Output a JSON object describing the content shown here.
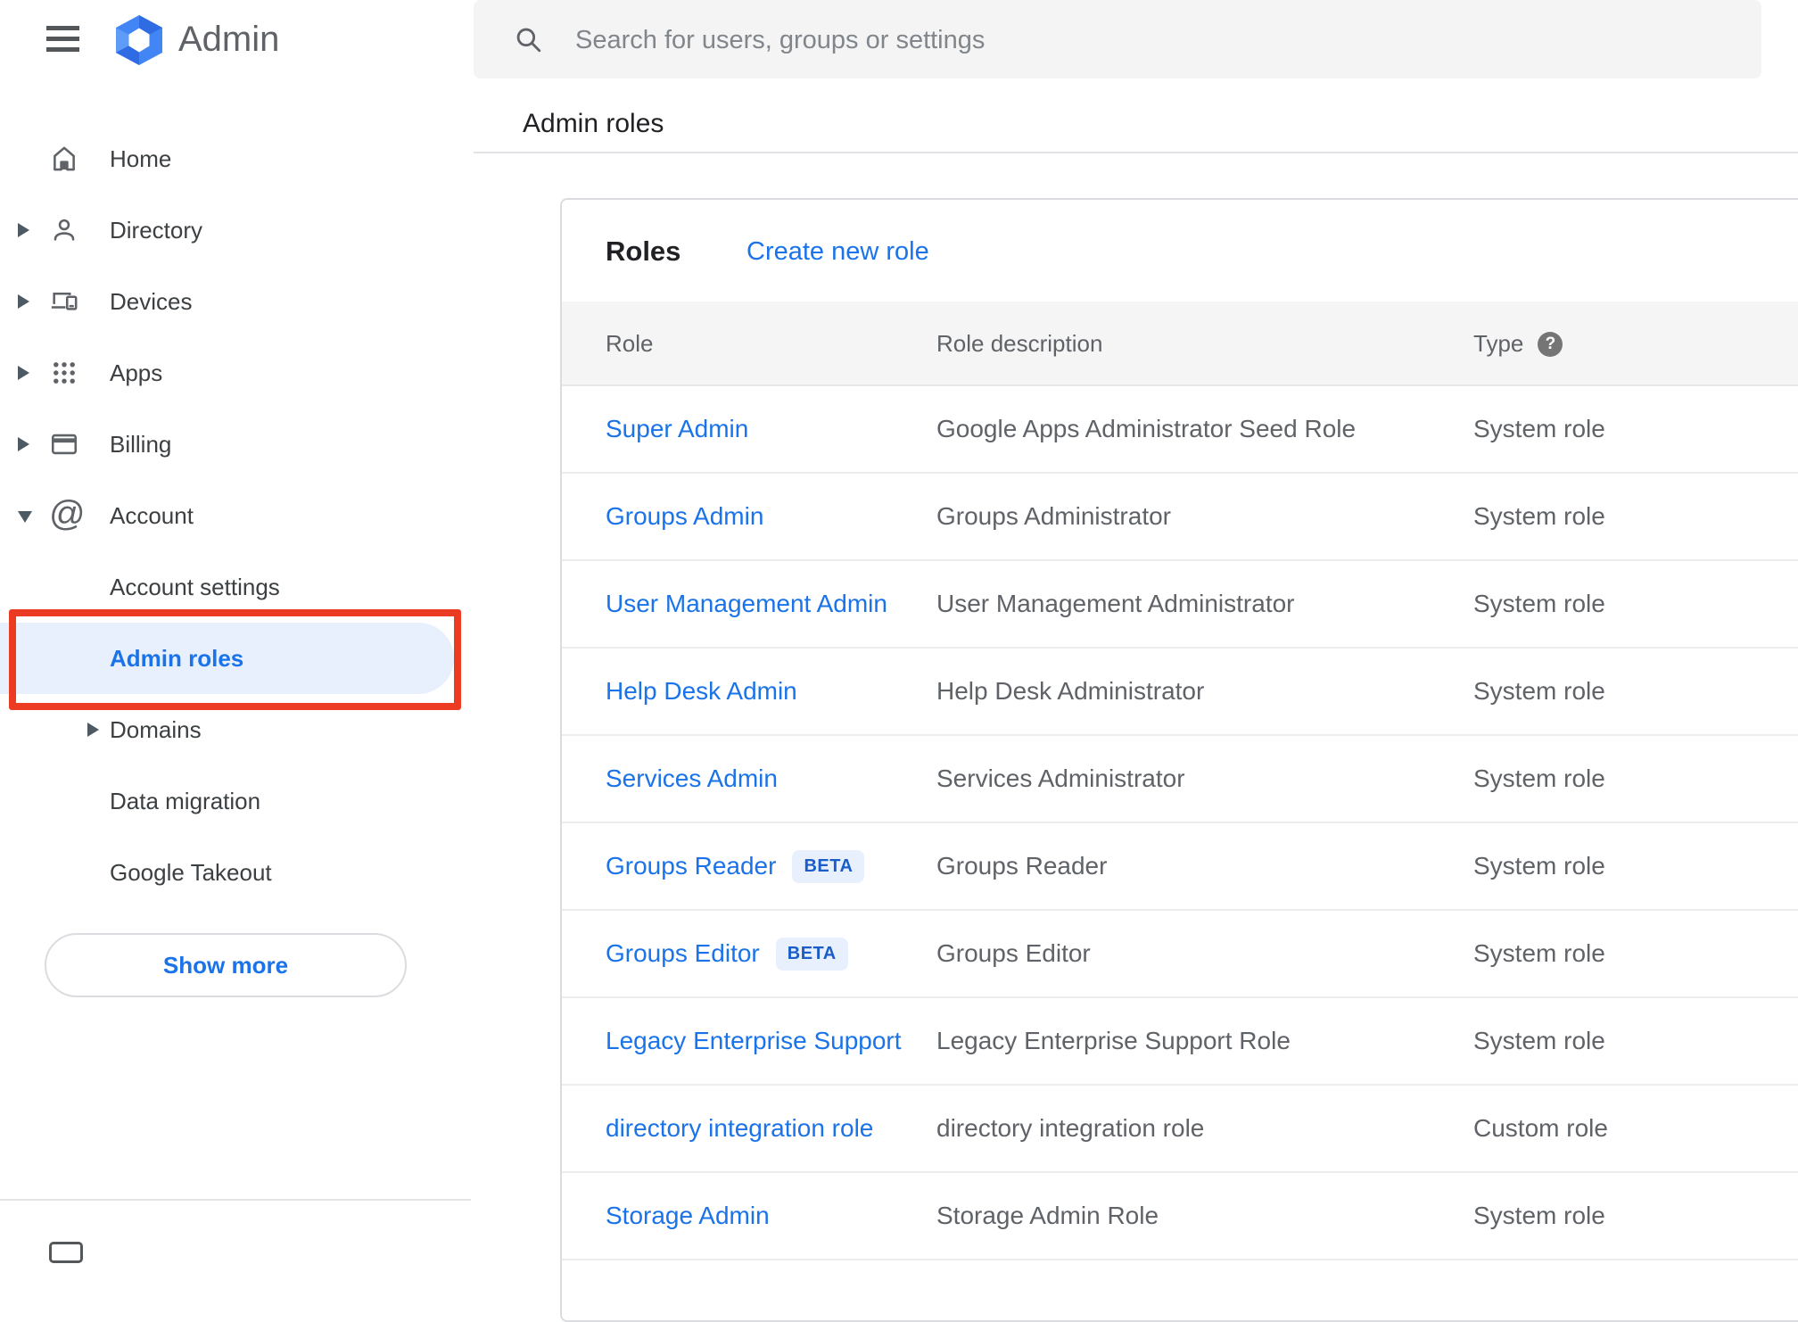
{
  "colors": {
    "accent": "#1a73e8",
    "annotation": "#ec3b23",
    "selected-bg": "#e8f0fe",
    "beta-bg": "#e8f0fe",
    "beta-text": "#1a5dc8"
  },
  "topbar": {
    "app_name": "Admin",
    "search_placeholder": "Search for users, groups or settings"
  },
  "sidebar": {
    "items": [
      {
        "label": "Home",
        "level": "top",
        "icon": "home"
      },
      {
        "label": "Directory",
        "level": "top",
        "icon": "directory",
        "arrow": "right"
      },
      {
        "label": "Devices",
        "level": "top",
        "icon": "devices",
        "arrow": "right"
      },
      {
        "label": "Apps",
        "level": "top",
        "icon": "apps",
        "arrow": "right"
      },
      {
        "label": "Billing",
        "level": "top",
        "icon": "billing",
        "arrow": "right"
      },
      {
        "label": "Account",
        "level": "top",
        "icon": "account",
        "arrow": "down"
      },
      {
        "label": "Account settings",
        "level": "sub"
      },
      {
        "label": "Admin roles",
        "level": "sub",
        "selected": true,
        "annotated": true
      },
      {
        "label": "Domains",
        "level": "sub",
        "arrow": "right"
      },
      {
        "label": "Data migration",
        "level": "sub"
      },
      {
        "label": "Google Takeout",
        "level": "sub"
      }
    ],
    "show_more_label": "Show more"
  },
  "content": {
    "heading": "Admin roles"
  },
  "card": {
    "title": "Roles",
    "create_link_label": "Create new role",
    "columns": [
      "Role",
      "Role description",
      "Type"
    ],
    "type_help_glyph": "?",
    "beta_label": "BETA",
    "rows": [
      {
        "role": "Super Admin",
        "beta": false,
        "description": "Google Apps Administrator Seed Role",
        "type": "System role"
      },
      {
        "role": "Groups Admin",
        "beta": false,
        "description": "Groups Administrator",
        "type": "System role"
      },
      {
        "role": "User Management Admin",
        "beta": false,
        "description": "User Management Administrator",
        "type": "System role"
      },
      {
        "role": "Help Desk Admin",
        "beta": false,
        "description": "Help Desk Administrator",
        "type": "System role"
      },
      {
        "role": "Services Admin",
        "beta": false,
        "description": "Services Administrator",
        "type": "System role"
      },
      {
        "role": "Groups Reader",
        "beta": true,
        "description": "Groups Reader",
        "type": "System role"
      },
      {
        "role": "Groups Editor",
        "beta": true,
        "description": "Groups Editor",
        "type": "System role"
      },
      {
        "role": "Legacy Enterprise Support",
        "beta": false,
        "description": "Legacy Enterprise Support Role",
        "type": "System role"
      },
      {
        "role": "directory integration role",
        "beta": false,
        "description": "directory integration role",
        "type": "Custom role"
      },
      {
        "role": "Storage Admin",
        "beta": false,
        "description": "Storage Admin Role",
        "type": "System role"
      }
    ]
  }
}
